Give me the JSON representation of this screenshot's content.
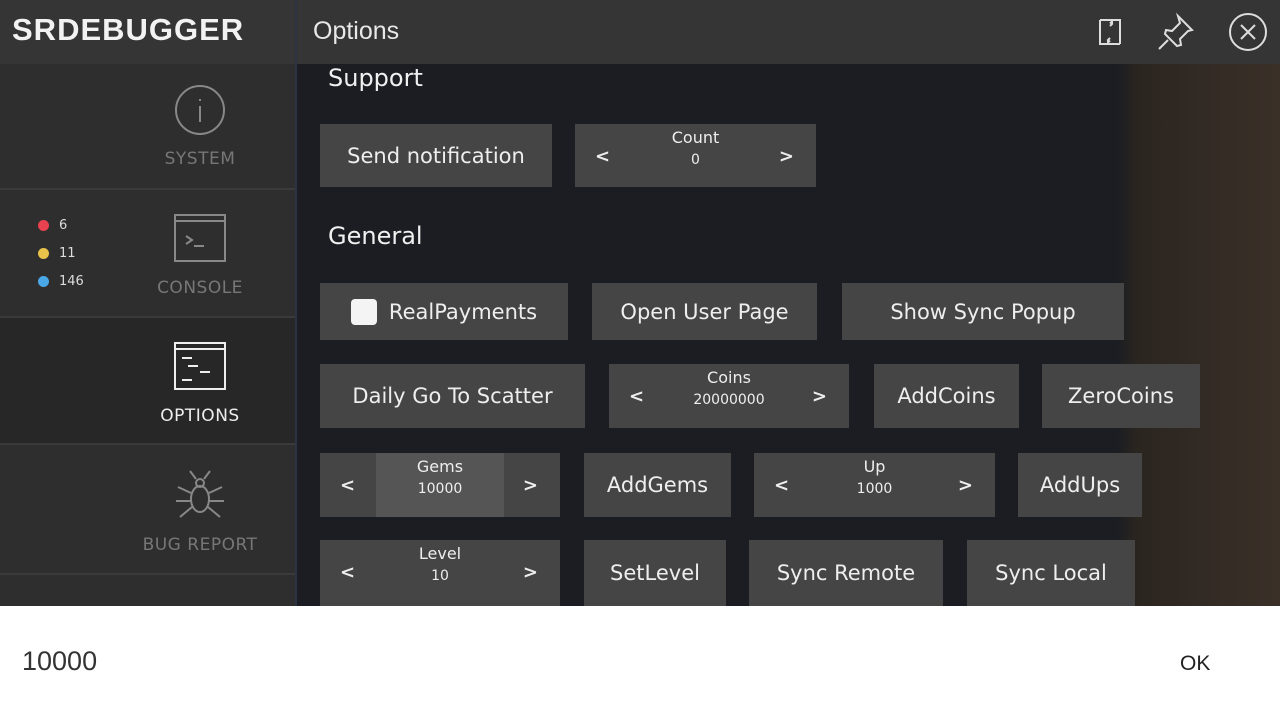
{
  "header": {
    "logo": "SRDEBUGGER",
    "title": "Options",
    "icons": [
      "refresh-icon",
      "pin-icon",
      "close-icon"
    ]
  },
  "sidebar": {
    "items": [
      {
        "label": "SYSTEM"
      },
      {
        "label": "CONSOLE"
      },
      {
        "label": "OPTIONS"
      },
      {
        "label": "BUG REPORT"
      }
    ],
    "console_counts": {
      "error": "6",
      "warning": "11",
      "info": "146"
    },
    "colors": {
      "error": "#e8414f",
      "warning": "#e8c24a",
      "info": "#4aa8e8"
    }
  },
  "sections": {
    "support": "Support",
    "general": "General"
  },
  "support": {
    "send_notification": "Send notification",
    "count": {
      "label": "Count",
      "value": "0"
    }
  },
  "general": {
    "real_payments": "RealPayments",
    "open_user_page": "Open User Page",
    "show_sync_popup": "Show Sync Popup",
    "daily_go_to_scatter": "Daily Go To Scatter",
    "coins": {
      "label": "Coins",
      "value": "20000000"
    },
    "add_coins": "AddCoins",
    "zero_coins": "ZeroCoins",
    "gems": {
      "label": "Gems",
      "value": "10000"
    },
    "add_gems": "AddGems",
    "up": {
      "label": "Up",
      "value": "1000"
    },
    "add_ups": "AddUps",
    "level": {
      "label": "Level",
      "value": "10"
    },
    "set_level": "SetLevel",
    "sync_remote": "Sync Remote",
    "sync_local": "Sync Local"
  },
  "stepper": {
    "prev": "<",
    "next": ">"
  },
  "input_bar": {
    "value": "10000",
    "ok": "OK"
  }
}
